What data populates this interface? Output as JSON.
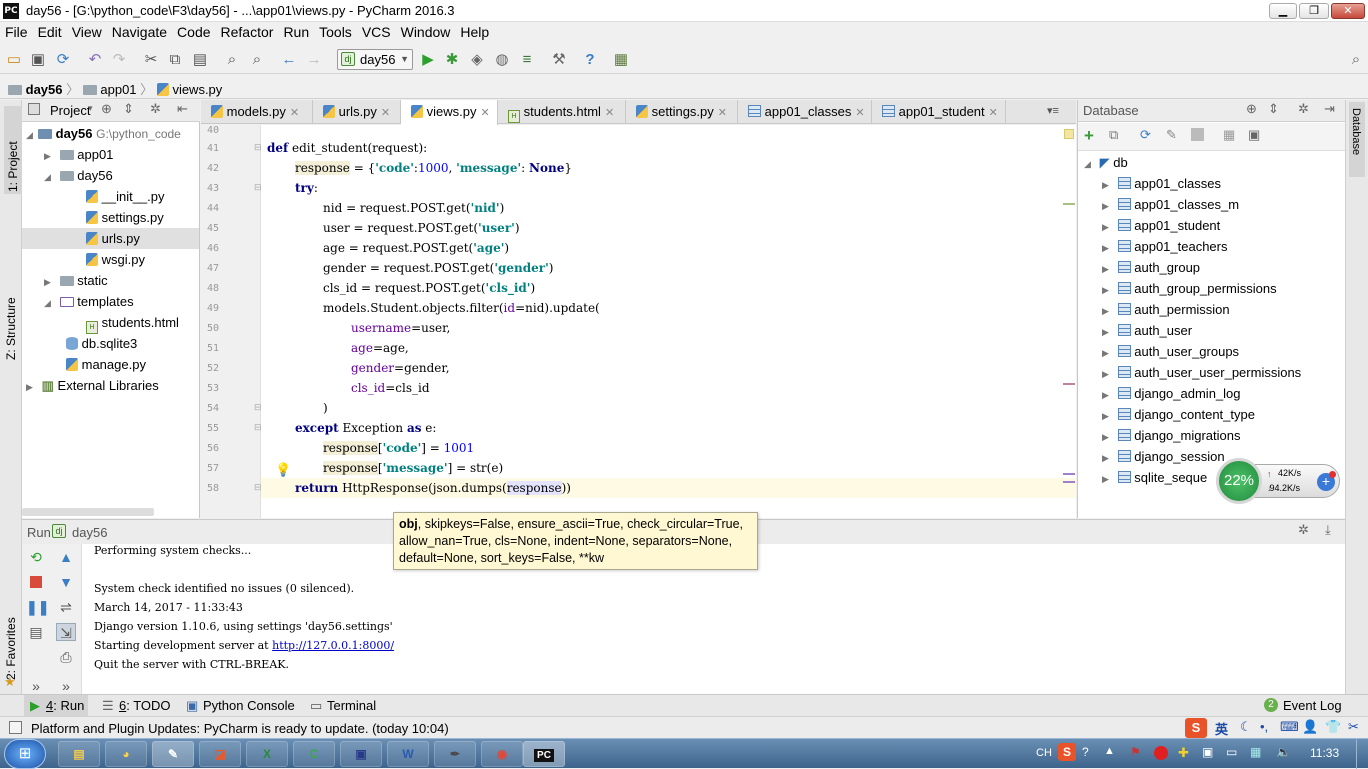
{
  "window": {
    "title": "day56 - [G:\\python_code\\F3\\day56] - ...\\app01\\views.py - PyCharm 2016.3",
    "app_icon": "PC"
  },
  "menu": [
    "File",
    "Edit",
    "View",
    "Navigate",
    "Code",
    "Refactor",
    "Run",
    "Tools",
    "VCS",
    "Window",
    "Help"
  ],
  "toolbar": {
    "run_config": "day56"
  },
  "breadcrumb": [
    "day56",
    "app01",
    "views.py"
  ],
  "left_tabs": {
    "project": "1: Project",
    "structure": "Z: Structure",
    "favorites": "2: Favorites"
  },
  "project_panel": {
    "title": "Project",
    "root": {
      "name": "day56",
      "path": "G:\\python_code"
    },
    "nodes": [
      {
        "label": "app01",
        "icon": "folder-icon"
      },
      {
        "label": "day56",
        "icon": "folder-icon"
      },
      {
        "label": "__init__.py",
        "icon": "python-file-icon"
      },
      {
        "label": "settings.py",
        "icon": "python-file-icon"
      },
      {
        "label": "urls.py",
        "icon": "python-file-icon"
      },
      {
        "label": "wsgi.py",
        "icon": "python-file-icon"
      },
      {
        "label": "static",
        "icon": "folder-icon"
      },
      {
        "label": "templates",
        "icon": "folder-icon"
      },
      {
        "label": "students.html",
        "icon": "html-file-icon"
      },
      {
        "label": "db.sqlite3",
        "icon": "database-file-icon"
      },
      {
        "label": "manage.py",
        "icon": "python-file-icon"
      },
      {
        "label": "External Libraries",
        "icon": "library-icon"
      }
    ]
  },
  "editor_tabs": [
    {
      "label": "models.py"
    },
    {
      "label": "urls.py"
    },
    {
      "label": "views.py"
    },
    {
      "label": "students.html"
    },
    {
      "label": "settings.py"
    },
    {
      "label": "app01_classes"
    },
    {
      "label": "app01_student"
    }
  ],
  "editor": {
    "line_numbers": [
      "40",
      "41",
      "42",
      "43",
      "44",
      "45",
      "46",
      "47",
      "48",
      "49",
      "50",
      "51",
      "52",
      "53",
      "54",
      "55",
      "56",
      "57",
      "58"
    ],
    "code": {
      "l41_kw": "def",
      "l41_rest": " edit_student(request):",
      "l42_var": "response",
      "l42_a": " = {",
      "l42_s1": "'code'",
      "l42_b": ":",
      "l42_n1": "1000",
      "l42_c": ", ",
      "l42_s2": "'message'",
      "l42_d": ": ",
      "l42_none": "None",
      "l42_e": "}",
      "l43_kw": "try",
      "l44_a": "nid = request.POST.get(",
      "l44_s": "'nid'",
      "l44_b": ")",
      "l45_a": "user = request.POST.get(",
      "l45_s": "'user'",
      "l45_b": ")",
      "l46_a": "age = request.POST.get(",
      "l46_s": "'age'",
      "l46_b": ")",
      "l47_a": "gender = request.POST.get(",
      "l47_s": "'gender'",
      "l47_b": ")",
      "l48_a": "cls_id = request.POST.get(",
      "l48_s": "'cls_id'",
      "l48_b": ")",
      "l49_a": "models.Student.objects.filter(",
      "l49_n": "id",
      "l49_b": "=nid).update(",
      "l50_n": "username",
      "l50_b": "=user,",
      "l51_n": "age",
      "l51_b": "=age,",
      "l52_n": "gender",
      "l52_b": "=gender,",
      "l53_n": "cls_id",
      "l53_b": "=cls_id",
      "l54": ")",
      "l55_kw1": "except",
      "l55_a": " Exception ",
      "l55_kw2": "as",
      "l55_b": " e:",
      "l56_var": "response",
      "l56_a": "[",
      "l56_s": "'code'",
      "l56_b": "] = ",
      "l56_n": "1001",
      "l57_var": "response",
      "l57_a": "[",
      "l57_s": "'message'",
      "l57_b": "] = str(e)",
      "l58_kw": "return",
      "l58_a": " HttpResponse(json.dumps(",
      "l58_var": "response",
      "l58_b": "))"
    }
  },
  "tooltip": {
    "bold": "obj",
    "text": ", skipkeys=False, ensure_ascii=True, check_circular=True, allow_nan=True, cls=None, indent=None, separators=None, default=None, sort_keys=False, **kw"
  },
  "database_panel": {
    "title": "Database",
    "side_tab": "Database",
    "root": "db",
    "tables": [
      "app01_classes",
      "app01_classes_m",
      "app01_student",
      "app01_teachers",
      "auth_group",
      "auth_group_permissions",
      "auth_permission",
      "auth_user",
      "auth_user_groups",
      "auth_user_user_permissions",
      "django_admin_log",
      "django_content_type",
      "django_migrations",
      "django_session",
      "sqlite_seque"
    ]
  },
  "widget": {
    "percent": "22%",
    "up": "42K/s",
    "down": "94.2K/s"
  },
  "run_panel": {
    "label": "Run",
    "config": "day56",
    "console": [
      "Performing system checks...",
      "",
      "System check identified no issues (0 silenced).",
      "March 14, 2017 - 11:33:43",
      "Django version 1.10.6, using settings 'day56.settings'",
      "Starting development server at ",
      "Quit the server with CTRL-BREAK."
    ],
    "server_link": "http://127.0.0.1:8000/"
  },
  "bottom_tabs": {
    "run_num": "4",
    "run": ": Run",
    "todo_num": "6",
    "todo": ": TODO",
    "console": "Python Console",
    "terminal": "Terminal",
    "event_badge": "2",
    "event": "Event Log"
  },
  "status": {
    "message": "Platform and Plugin Updates: PyCharm is ready to update. (today 10:04)"
  },
  "taskbar": {
    "apps": [
      "explorer",
      "paint",
      "notepad",
      "office",
      "excel",
      "c-app",
      "save-app",
      "word",
      "pen-app",
      "chrome",
      "pycharm"
    ],
    "tray_lang": "CH",
    "ime": "英",
    "clock": "11:33"
  }
}
